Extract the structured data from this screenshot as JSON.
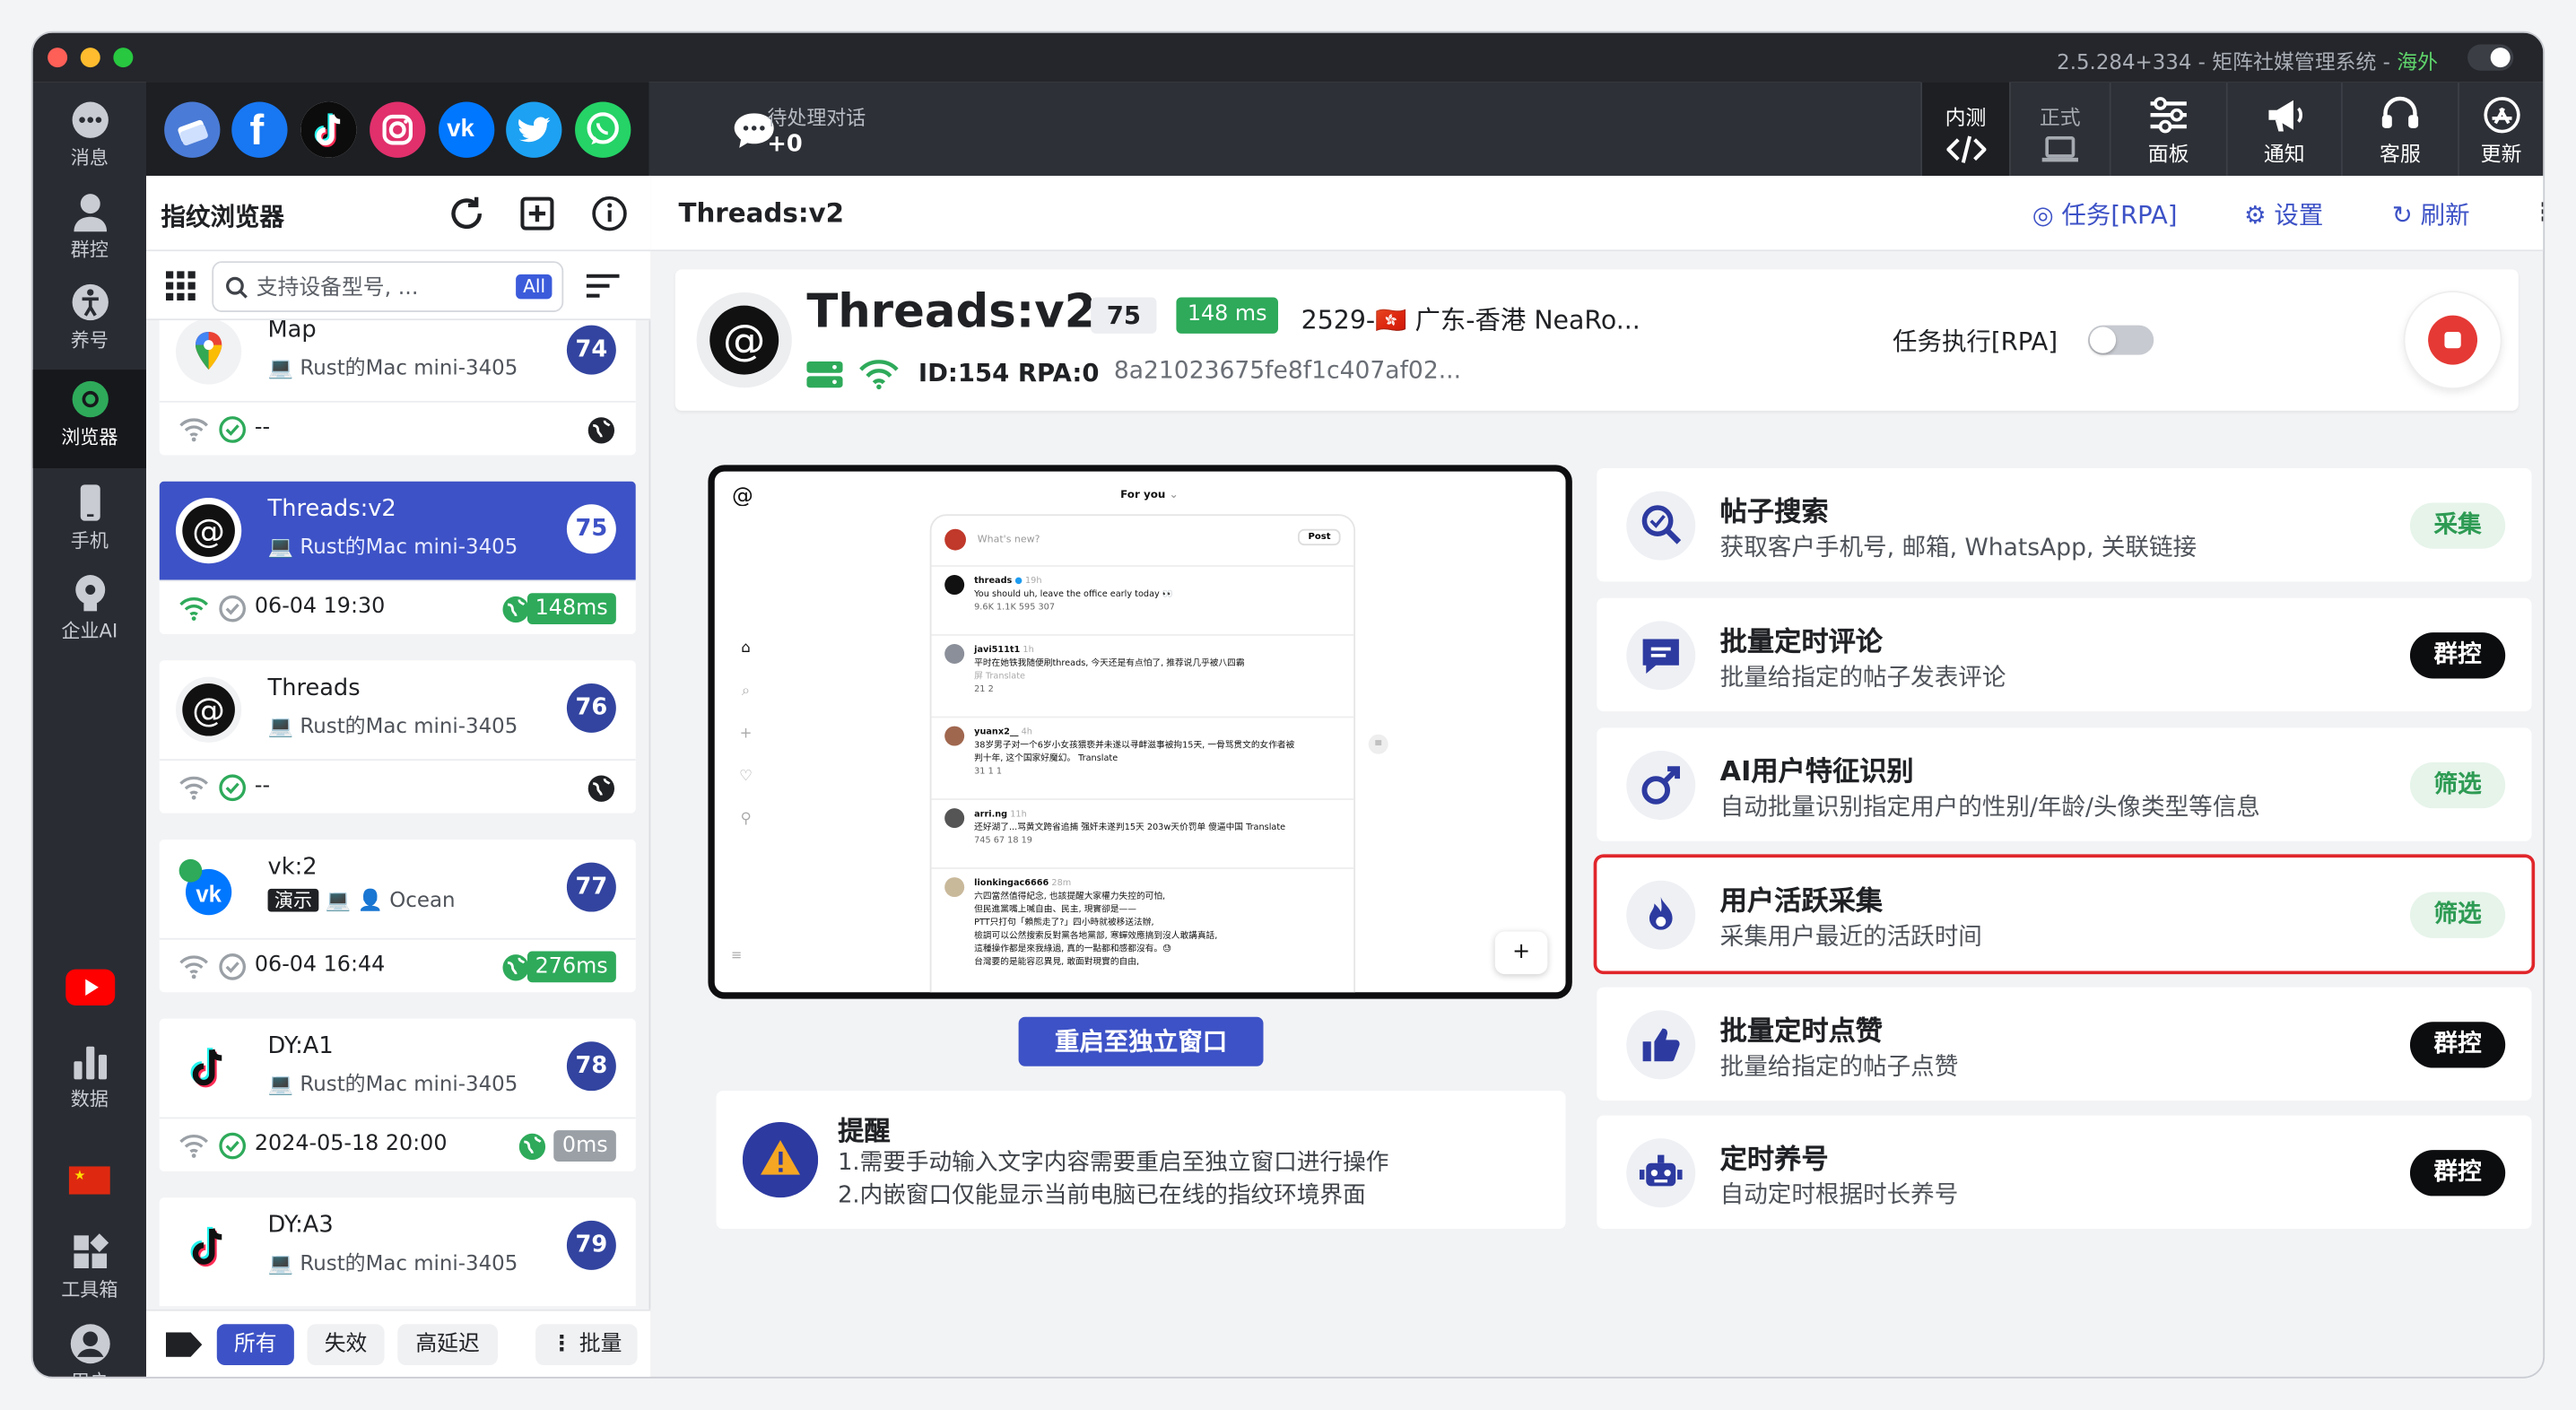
{
  "window": {
    "version_text": "2.5.284+334 - 矩阵社媒管理系统 -",
    "region": "海外"
  },
  "nav": [
    {
      "label": "消息",
      "icon": "message-icon"
    },
    {
      "label": "群控",
      "icon": "group-control-icon"
    },
    {
      "label": "养号",
      "icon": "account-nurture-icon"
    },
    {
      "label": "浏览器",
      "icon": "browser-icon"
    },
    {
      "label": "手机",
      "icon": "phone-icon"
    },
    {
      "label": "企业AI",
      "icon": "enterprise-ai-icon"
    },
    {
      "label": "数据",
      "icon": "data-icon"
    },
    {
      "label": "工具箱",
      "icon": "toolbox-icon"
    },
    {
      "label": "用户",
      "icon": "user-icon"
    }
  ],
  "platforms": [
    "multi-account-icon",
    "facebook-icon",
    "tiktok-icon",
    "instagram-icon",
    "vk-icon",
    "twitter-icon",
    "whatsapp-icon"
  ],
  "pending": {
    "title": "待处理对话",
    "count": "+0"
  },
  "topbar": {
    "internal_label": "内测",
    "formal_label": "正式",
    "panel_label": "面板",
    "notice_label": "通知",
    "service_label": "客服",
    "update_label": "更新"
  },
  "sidebar": {
    "title": "指纹浏览器",
    "search_placeholder": "支持设备型号, ...",
    "all_badge": "All",
    "profiles": [
      {
        "name": "Map",
        "device": "Rust的Mac mini-3405",
        "badge": "74",
        "time": "--",
        "ms": ""
      },
      {
        "name": "Threads:v2",
        "device": "Rust的Mac mini-3405",
        "badge": "75",
        "time": "06-04 19:30",
        "ms": "148ms"
      },
      {
        "name": "Threads",
        "device": "Rust的Mac mini-3405",
        "badge": "76",
        "time": "--",
        "ms": ""
      },
      {
        "name": "vk:2",
        "tag": "演示",
        "device": "Ocean",
        "badge": "77",
        "time": "06-04 16:44",
        "ms": "276ms"
      },
      {
        "name": "DY:A1",
        "device": "Rust的Mac mini-3405",
        "badge": "78",
        "time": "2024-05-18 20:00",
        "ms": "0ms"
      },
      {
        "name": "DY:A3",
        "device": "Rust的Mac mini-3405",
        "badge": "79"
      }
    ],
    "filters": {
      "all": "所有",
      "invalid": "失效",
      "high_latency": "高延迟",
      "batch": "批量"
    }
  },
  "main": {
    "title": "Threads:v2",
    "actions": {
      "task": "任务[RPA]",
      "settings": "设置",
      "refresh": "刷新"
    },
    "info": {
      "name": "Threads:v2",
      "badge": "75",
      "ms": "148 ms",
      "location": "2529-🇭🇰 广东-香港 NeaRo...",
      "id": "ID:154",
      "rpa": "RPA:0",
      "hash": "8a21023675fe8f1c407af02...",
      "task_exec": "任务执行[RPA]"
    },
    "browser": {
      "header": "For you",
      "compose": "What's new?",
      "post_btn": "Post",
      "posts": [
        {
          "user": "threads",
          "time": "19h",
          "text": "You should uh, leave the office early today 👀",
          "stats": "9.6K   1.1K   595   307"
        },
        {
          "user": "javi511t1",
          "time": "1h",
          "text": "平时在她铁我随便刷threads, 今天还是有点怕了, 推荐说几乎被八四霸",
          "text2": "屏  Translate",
          "stats": "21   2"
        },
        {
          "user": "yuanx2__",
          "time": "4h",
          "text": "38岁男子对一个6岁小女孩猥亵并未遂以寻衅滋事被拘15天, 一骨骂贯文的女作者被",
          "text2": "判十年, 这个国家好魔幻。 Translate",
          "stats": "31   1   1"
        },
        {
          "user": "arri.ng",
          "time": "11h",
          "text": "还好湖了...骂黄文跨省追捕 强奸未遂判15天 203w天价罚单 傻逼中国 Translate",
          "stats": "745   67   18   19"
        },
        {
          "user": "lionkingac6666",
          "time": "28m",
          "text": "六四當然值得紀念, 也該提醒大家權力失控的可怕,",
          "text2": "但民進黨嘴上喊自由、民主, 現實卻是——",
          "text3": "PTT只打句「賴熊走了?」四小時就被移送法辦,",
          "text4": "檢調可以公然搜索反對黨各地黨部, 寒蟬效應搞到沒人敢講真話,",
          "text5": "這種操作都是來我綠過, 真的一點都和感都沒有。😓",
          "text6": "台灣要的是能容忍異見, 敢面對現實的自由,"
        }
      ]
    },
    "restart_label": "重启至独立窗口",
    "reminder": {
      "title": "提醒",
      "line1": "1.需要手动输入文字内容需要重启至独立窗口进行操作",
      "line2": "2.内嵌窗口仅能显示当前电脑已在线的指纹环境界面"
    },
    "features": [
      {
        "title": "帖子搜索",
        "desc": "获取客户手机号, 邮箱, WhatsApp, 关联链接",
        "button": "采集",
        "style": "green",
        "icon": "post-search-icon"
      },
      {
        "title": "批量定时评论",
        "desc": "批量给指定的帖子发表评论",
        "button": "群控",
        "style": "dark",
        "icon": "comment-icon"
      },
      {
        "title": "AI用户特征识别",
        "desc": "自动批量识别指定用户的性别/年龄/头像类型等信息",
        "button": "筛选",
        "style": "green",
        "icon": "gender-icon"
      },
      {
        "title": "用户活跃采集",
        "desc": "采集用户最近的活跃时间",
        "button": "筛选",
        "style": "green",
        "icon": "fire-icon"
      },
      {
        "title": "批量定时点赞",
        "desc": "批量给指定的帖子点赞",
        "button": "群控",
        "style": "dark",
        "icon": "thumbs-up-icon"
      },
      {
        "title": "定时养号",
        "desc": "自动定时根据时长养号",
        "button": "群控",
        "style": "dark",
        "icon": "robot-icon"
      }
    ]
  },
  "colors": {
    "accent": "#3d52c6",
    "green": "#2eaa5a",
    "highlight": "#e0262b",
    "dark": "#2a2c33"
  }
}
